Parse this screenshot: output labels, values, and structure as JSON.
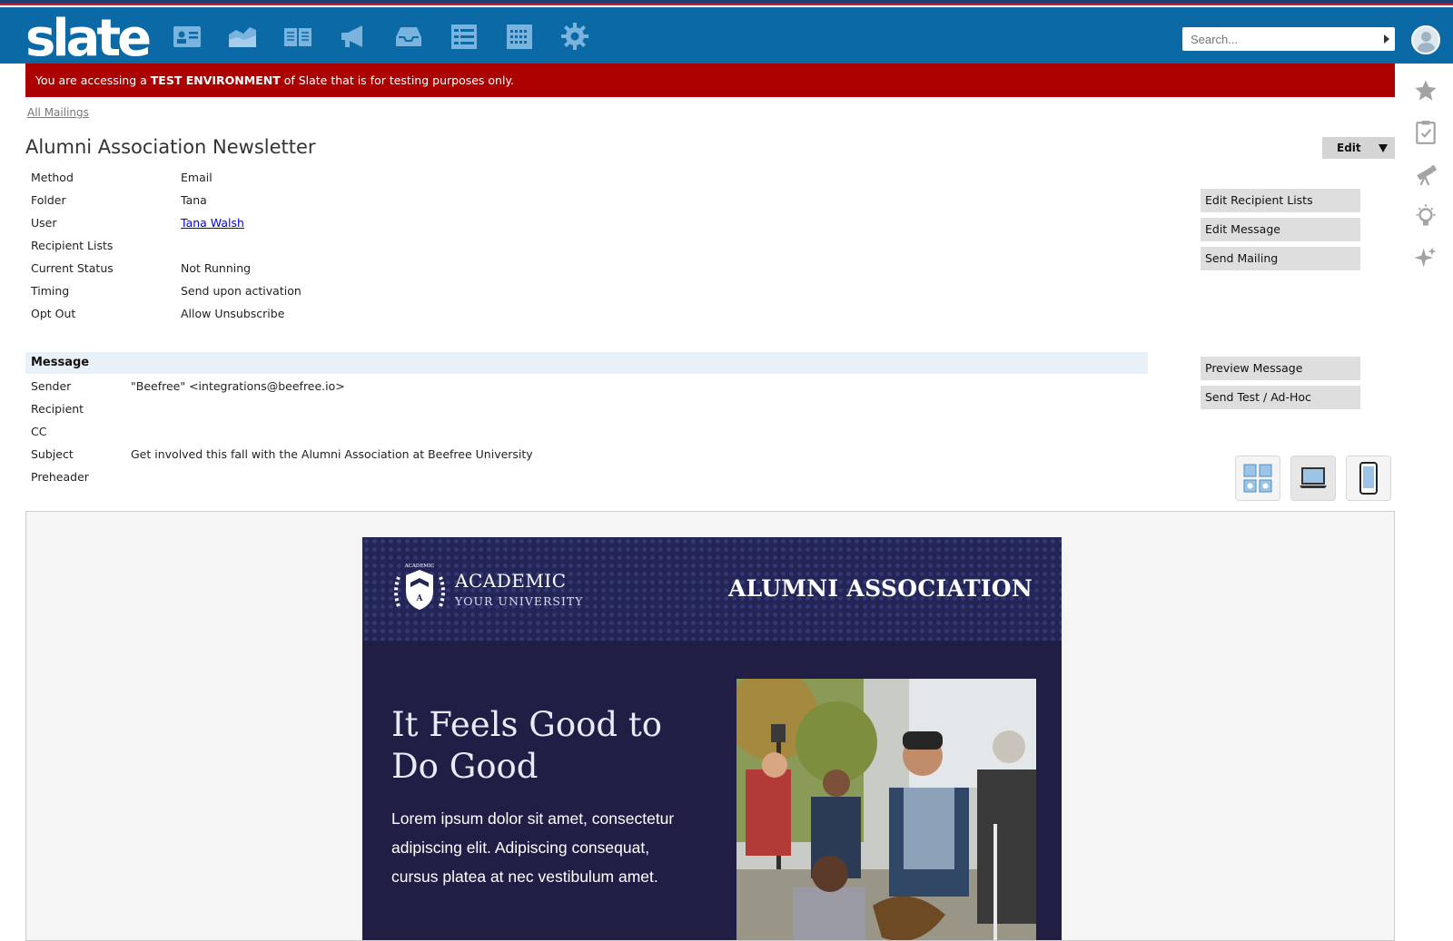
{
  "header": {
    "logo_text": "slate",
    "nav_icons": [
      "contact-card-icon",
      "chart-area-icon",
      "book-icon",
      "megaphone-icon",
      "inbox-icon",
      "list-icon",
      "calendar-icon",
      "gear-icon"
    ],
    "search_placeholder": "Search...",
    "color": "#0b6aa6"
  },
  "banner": {
    "prefix": "You are accessing a ",
    "emphasis": "TEST ENVIRONMENT",
    "suffix": " of Slate that is for testing purposes only.",
    "color": "#ad0000"
  },
  "breadcrumb": {
    "label": "All Mailings"
  },
  "page": {
    "title": "Alumni Association Newsletter",
    "edit_label": "Edit"
  },
  "properties": [
    {
      "key": "Method",
      "value": "Email"
    },
    {
      "key": "Folder",
      "value": "Tana"
    },
    {
      "key": "User",
      "value": "Tana Walsh",
      "link": true
    },
    {
      "key": "Recipient Lists",
      "value": ""
    },
    {
      "key": "Current Status",
      "value": "Not Running"
    },
    {
      "key": "Timing",
      "value": "Send upon activation"
    },
    {
      "key": "Opt Out",
      "value": "Allow Unsubscribe"
    }
  ],
  "actions_top": [
    "Edit Recipient Lists",
    "Edit Message",
    "Send Mailing"
  ],
  "actions_bottom": [
    "Preview Message",
    "Send Test / Ad-Hoc"
  ],
  "message": {
    "heading": "Message",
    "fields": [
      {
        "key": "Sender",
        "value": "\"Beefree\" <integrations@beefree.io>"
      },
      {
        "key": "Recipient",
        "value": ""
      },
      {
        "key": "CC",
        "value": ""
      },
      {
        "key": "Subject",
        "value": "Get involved this fall with the Alumni Association at Beefree University"
      },
      {
        "key": "Preheader",
        "value": ""
      }
    ]
  },
  "view_modes": [
    "layout-icon",
    "desktop-icon",
    "mobile-icon"
  ],
  "email": {
    "brand": "ACADEMIC",
    "brand_sub": "YOUR UNIVERSITY",
    "crest_text": "ACADEMIC",
    "header_title": "ALUMNI ASSOCIATION",
    "hero_title": "It Feels Good to Do Good",
    "hero_body": "Lorem ipsum dolor sit amet, consectetur adipiscing elit. Adipiscing consequat, cursus platea at nec vestibulum amet.",
    "bg_color": "#201e45"
  },
  "right_rail": [
    "star-icon",
    "clipboard-check-icon",
    "telescope-icon",
    "lightbulb-icon",
    "sparkles-icon"
  ]
}
